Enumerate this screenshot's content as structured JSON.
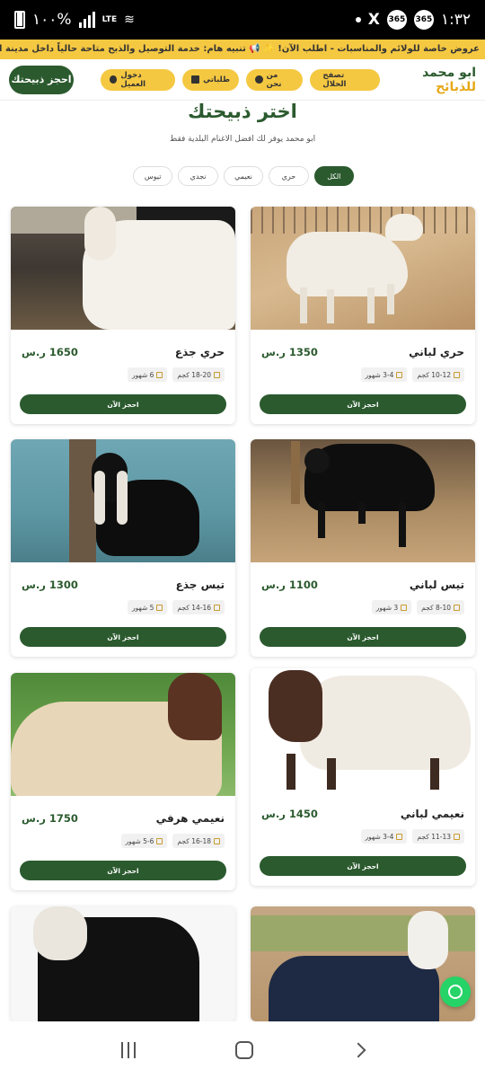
{
  "status_bar": {
    "time": "١:٣٢",
    "battery": "١٠٠%",
    "network": "LTE",
    "operator_badge": "365"
  },
  "ticker": {
    "text": "عروض خاصة للولائم والمناسبات - اطلب الآن! ✨ 📢 تنبيه هام: خدمة التوصيل والذبح متاحة حالياً داخل مدينة الرياض وضواحيها فقط"
  },
  "header": {
    "logo_main": "ابو محمد",
    "logo_accent": "للذبائح",
    "nav": [
      {
        "label": "تصفح الحلال",
        "icon": ""
      },
      {
        "label": "من نحن",
        "icon": "info-icon"
      },
      {
        "label": "طلباتي",
        "icon": "receipt-icon"
      },
      {
        "label": "دخول العميل",
        "icon": "user-icon"
      }
    ],
    "cta": "احجز ذبيحتك"
  },
  "section": {
    "title": "اختر ذبيحتك",
    "subtitle": "ابو محمد يوفر لك افضل الاغنام البلدية فقط"
  },
  "filters": [
    "الكل",
    "حري",
    "نعيمي",
    "نجدي",
    "تيوس"
  ],
  "active_filter": "الكل",
  "products": [
    {
      "name": "حري لباني",
      "price": "1350 ر.س",
      "weight": "10-12 كجم",
      "age": "3-4 شهور",
      "button": "احجز الآن"
    },
    {
      "name": "حري جذع",
      "price": "1650 ر.س",
      "weight": "18-20 كجم",
      "age": "6 شهور",
      "button": "احجز الآن"
    },
    {
      "name": "تيس لباني",
      "price": "1100 ر.س",
      "weight": "8-10 كجم",
      "age": "3 شهور",
      "button": "احجز الآن"
    },
    {
      "name": "تيس جذع",
      "price": "1300 ر.س",
      "weight": "14-16 كجم",
      "age": "5 شهور",
      "button": "احجز الآن"
    },
    {
      "name": "نعيمي لباني",
      "price": "1450 ر.س",
      "weight": "11-13 كجم",
      "age": "3-4 شهور",
      "button": "احجز الآن"
    },
    {
      "name": "نعيمي هرفي",
      "price": "1750 ر.س",
      "weight": "16-18 كجم",
      "age": "5-6 شهور",
      "button": "احجز الآن"
    }
  ],
  "colors": {
    "primary": "#2b5a2e",
    "accent": "#f5c842",
    "whatsapp": "#25d366"
  }
}
